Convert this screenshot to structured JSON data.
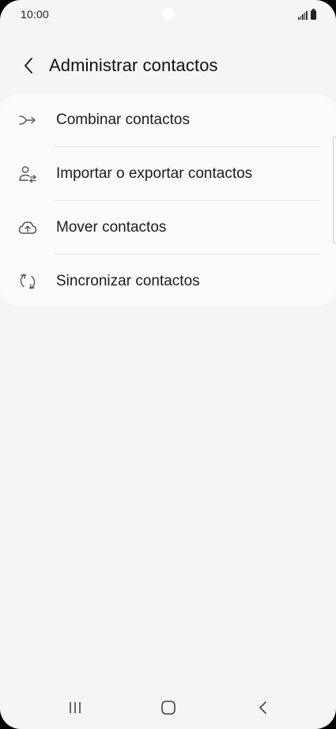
{
  "status_bar": {
    "time": "10:00"
  },
  "header": {
    "back_icon": "chevron-left-icon",
    "title": "Administrar contactos"
  },
  "menu": {
    "items": [
      {
        "label": "Combinar contactos",
        "icon": "merge-arrow-icon"
      },
      {
        "label": "Importar o exportar contactos",
        "icon": "person-transfer-icon"
      },
      {
        "label": "Mover contactos",
        "icon": "cloud-upload-icon"
      },
      {
        "label": "Sincronizar contactos",
        "icon": "sync-icon"
      }
    ]
  },
  "nav_bar": {
    "recents_icon": "recents-icon",
    "home_icon": "home-icon",
    "back_icon": "back-icon"
  },
  "colors": {
    "background": "#f5f5f5",
    "card": "#fbfbfb",
    "text": "#1c1c1c",
    "icon": "#555555"
  }
}
